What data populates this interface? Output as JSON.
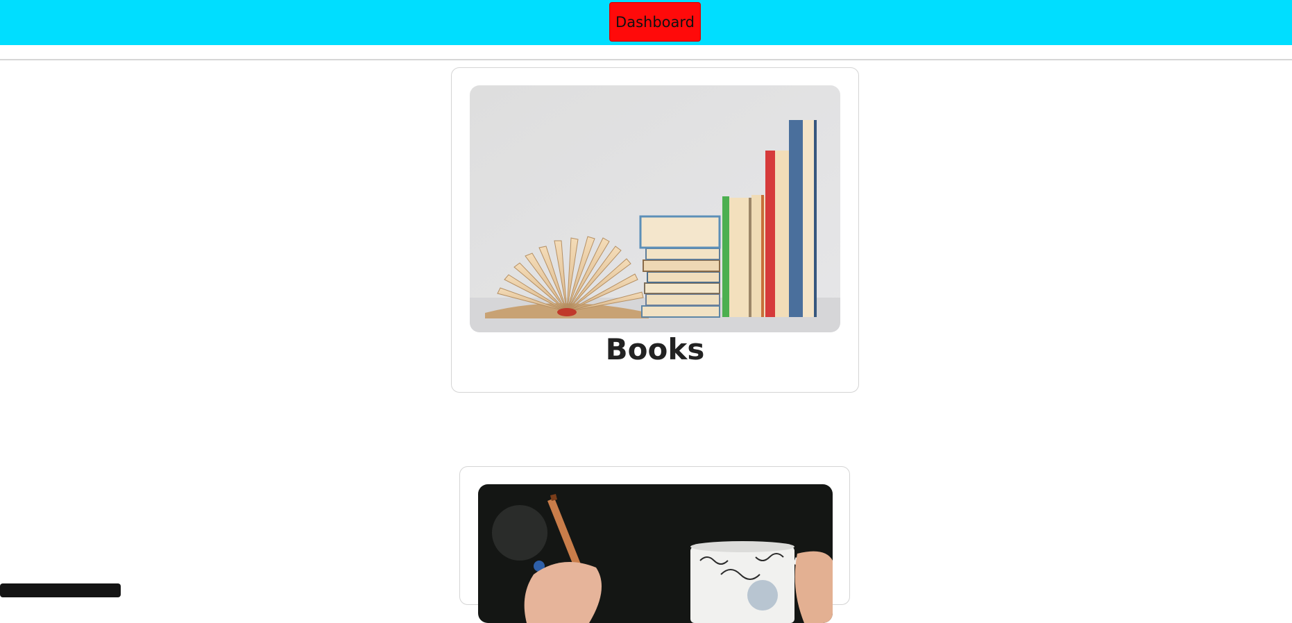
{
  "topbar": {
    "dashboard_label": "Dashboard",
    "background_color": "#00deff",
    "button_color": "#ff0a0a"
  },
  "cards": [
    {
      "title": "Books",
      "image": "books-photo"
    },
    {
      "title": "",
      "image": "writing-coffee-photo"
    }
  ]
}
